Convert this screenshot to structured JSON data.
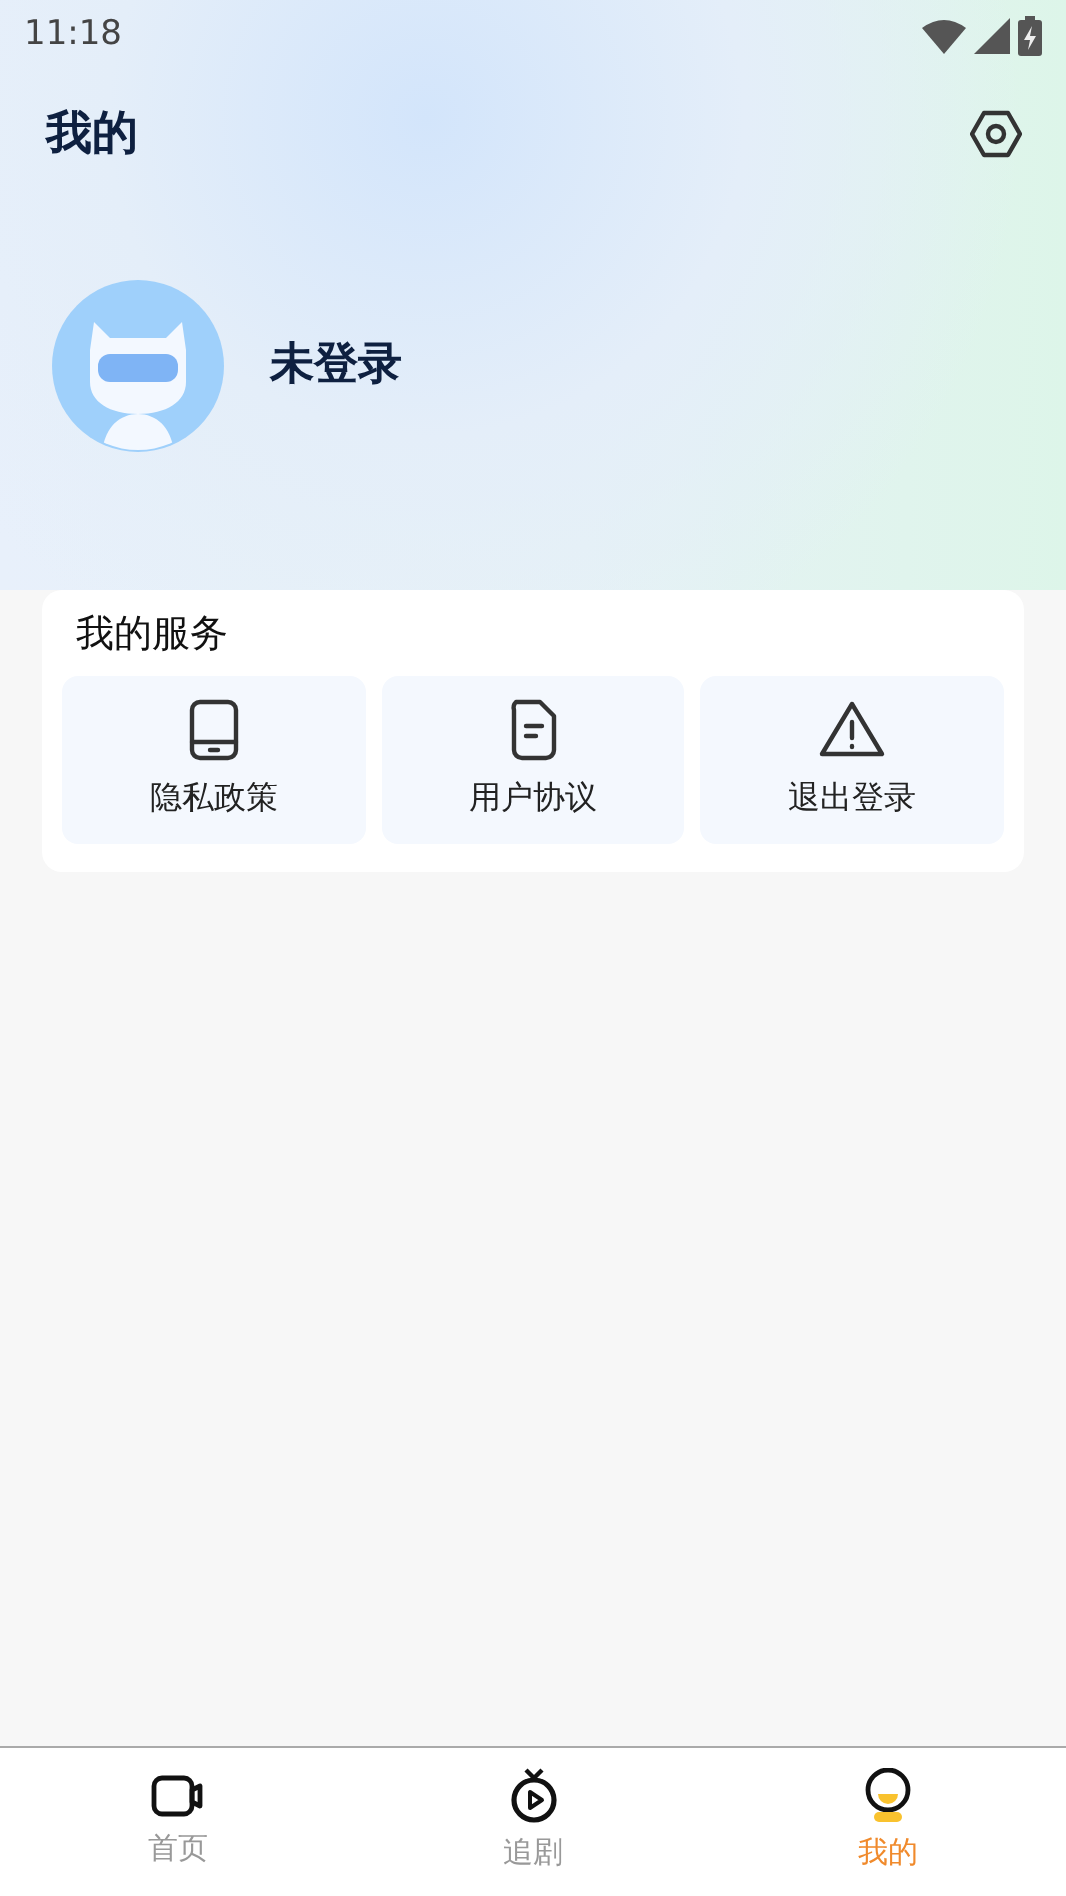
{
  "status_bar": {
    "time": "11:18"
  },
  "header": {
    "title": "我的"
  },
  "profile": {
    "name": "未登录"
  },
  "services": {
    "title": "我的服务",
    "items": [
      {
        "label": "隐私政策",
        "kind": "phone"
      },
      {
        "label": "用户协议",
        "kind": "document"
      },
      {
        "label": "退出登录",
        "kind": "warning"
      }
    ]
  },
  "tabs": [
    {
      "label": "首页",
      "kind": "video",
      "selected": false
    },
    {
      "label": "追剧",
      "kind": "play",
      "selected": false
    },
    {
      "label": "我的",
      "kind": "user",
      "selected": true
    }
  ]
}
